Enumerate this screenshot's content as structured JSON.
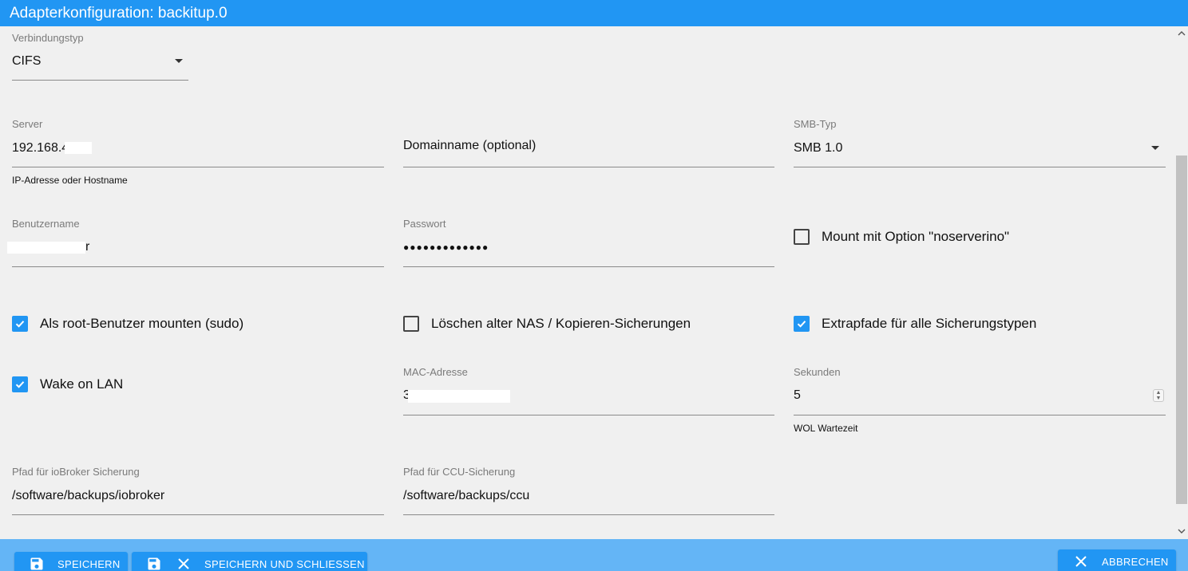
{
  "window": {
    "title": "Adapterkonfiguration: backitup.0"
  },
  "connection": {
    "label": "Verbindungstyp",
    "value": "CIFS"
  },
  "server": {
    "label": "Server",
    "value": "192.168.4",
    "helper": "IP-Adresse oder Hostname"
  },
  "domain": {
    "placeholder": "Domainname (optional)"
  },
  "smb": {
    "label": "SMB-Typ",
    "value": "SMB 1.0"
  },
  "username": {
    "label": "Benutzername",
    "value": "r"
  },
  "password": {
    "label": "Passwort",
    "value": "●●●●●●●●●●●●●"
  },
  "checkboxes": {
    "noserverino": {
      "label": "Mount mit Option \"noserverino\"",
      "checked": false
    },
    "sudo": {
      "label": "Als root-Benutzer mounten (sudo)",
      "checked": true
    },
    "delete_old": {
      "label": "Löschen alter NAS / Kopieren-Sicherungen",
      "checked": false
    },
    "extrapaths": {
      "label": "Extrapfade für alle Sicherungstypen",
      "checked": true
    },
    "wol": {
      "label": "Wake on LAN",
      "checked": true
    }
  },
  "mac": {
    "label": "MAC-Adresse",
    "value": "3"
  },
  "seconds": {
    "label": "Sekunden",
    "value": "5",
    "helper": "WOL Wartezeit"
  },
  "iobroker_path": {
    "label": "Pfad für ioBroker Sicherung",
    "value": "/software/backups/iobroker"
  },
  "ccu_path": {
    "label": "Pfad für CCU-Sicherung",
    "value": "/software/backups/ccu"
  },
  "footer": {
    "save": "SPEICHERN",
    "save_close": "SPEICHERN UND SCHLIESSEN",
    "cancel": "ABBRECHEN"
  },
  "colors": {
    "accent": "#2196f3",
    "footer": "#64b5f6",
    "background": "#f0f0f0"
  }
}
